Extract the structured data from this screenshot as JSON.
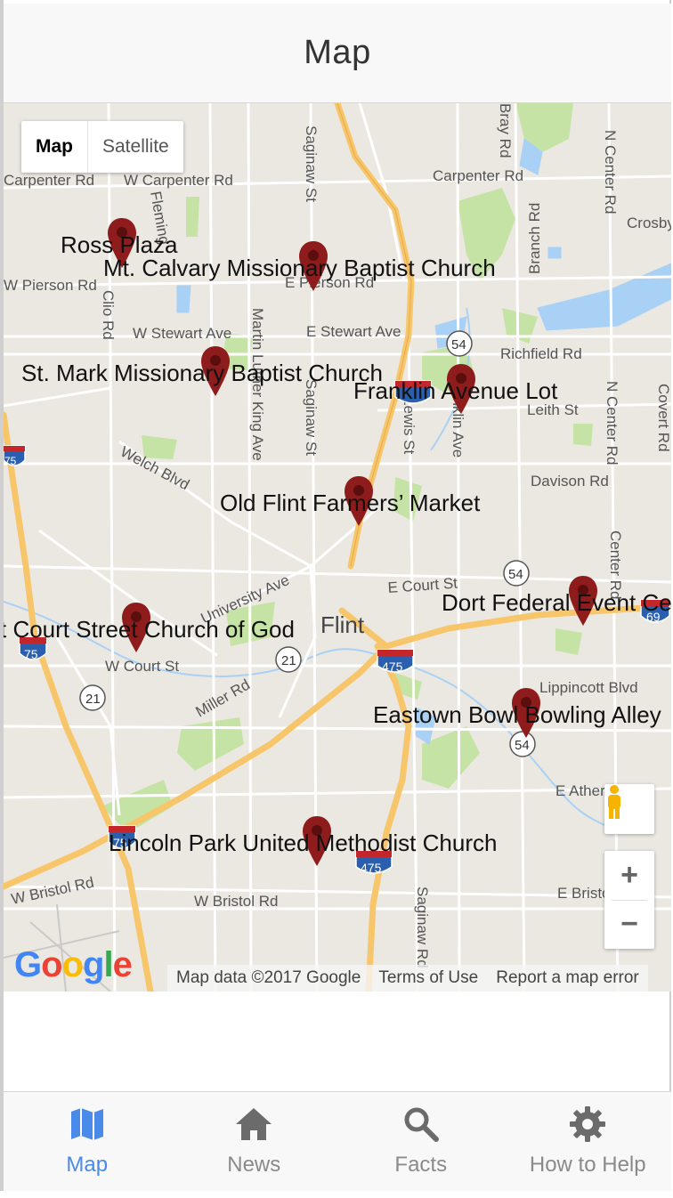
{
  "header": {
    "title": "Map"
  },
  "map": {
    "type_control": {
      "map_label": "Map",
      "satellite_label": "Satellite",
      "selected": "Map"
    },
    "markers": [
      {
        "label": "Ross Plaza"
      },
      {
        "label": "Mt. Calvary Missionary Baptist Church"
      },
      {
        "label": "St. Mark Missionary Baptist Church"
      },
      {
        "label": "Franklin Avenue Lot"
      },
      {
        "label": "Old Flint Farmers’ Market"
      },
      {
        "label": "Dort Federal Event Ce"
      },
      {
        "label": "t Court Street Church of God"
      },
      {
        "label": "Eastown Bowl Bowling Alley"
      },
      {
        "label": "Lincoln Park United Methodist Church"
      }
    ],
    "road_labels": {
      "carpenter_w1": "Carpenter Rd",
      "carpenter_w2": "W Carpenter Rd",
      "carpenter_e": "Carpenter Rd",
      "pierson_w": "W Pierson Rd",
      "pierson_e": "E Pierson Rd",
      "stewart_w": "W Stewart Ave",
      "stewart_e": "E Stewart Ave",
      "richfield": "Richfield Rd",
      "leith": "Leith St",
      "davison": "Davison Rd",
      "welch": "Welch Blvd",
      "court_e": "E Court St",
      "court_w": "W Court St",
      "university": "University Ave",
      "miller": "Miller Rd",
      "lippincott": "Lippincott Blvd",
      "atherton": "E Atherton",
      "bristol_w1": "W Bristol Rd",
      "bristol_w2": "W Bristol Rd",
      "bristol_e": "E Bristol",
      "saginaw1": "Saginaw St",
      "saginaw2": "Saginaw St",
      "saginaw3": "Saginaw Rd",
      "mlk": "Martin Luther King Ave",
      "lewis": "Lewis St",
      "franklin": "Franklin Ave",
      "n_center1": "N Center Rd",
      "n_center2": "N Center Rd",
      "center": "Center Rd",
      "branch": "Branch Rd",
      "bray": "Bray Rd",
      "clio": "Clio Rd",
      "crosby": "Crosby",
      "covert": "Covert Rd",
      "fleming": "Fleming",
      "city": "Flint"
    },
    "shields": {
      "i75_a": "75",
      "i75_b": "75",
      "i75_c": "75",
      "i475_a": "475",
      "i475_b": "475",
      "i69": "69",
      "r54_a": "54",
      "r54_b": "54",
      "r54_c": "54",
      "r21_a": "21",
      "r21_b": "21"
    },
    "google_logo": "Google",
    "attribution": {
      "data": "Map data ©2017 Google",
      "terms": "Terms of Use",
      "report": "Report a map error"
    },
    "zoom": {
      "in": "+",
      "out": "−"
    }
  },
  "tabs": [
    {
      "label": "Map",
      "icon": "map-icon",
      "active": true
    },
    {
      "label": "News",
      "icon": "home-icon",
      "active": false
    },
    {
      "label": "Facts",
      "icon": "search-icon",
      "active": false
    },
    {
      "label": "How to Help",
      "icon": "gear-icon",
      "active": false
    }
  ],
  "colors": {
    "accent": "#4a8ae8",
    "pin": "#8e1c1c",
    "highway": "#f7c66b",
    "park": "#c5e3a5",
    "water": "#a9d0f5"
  }
}
